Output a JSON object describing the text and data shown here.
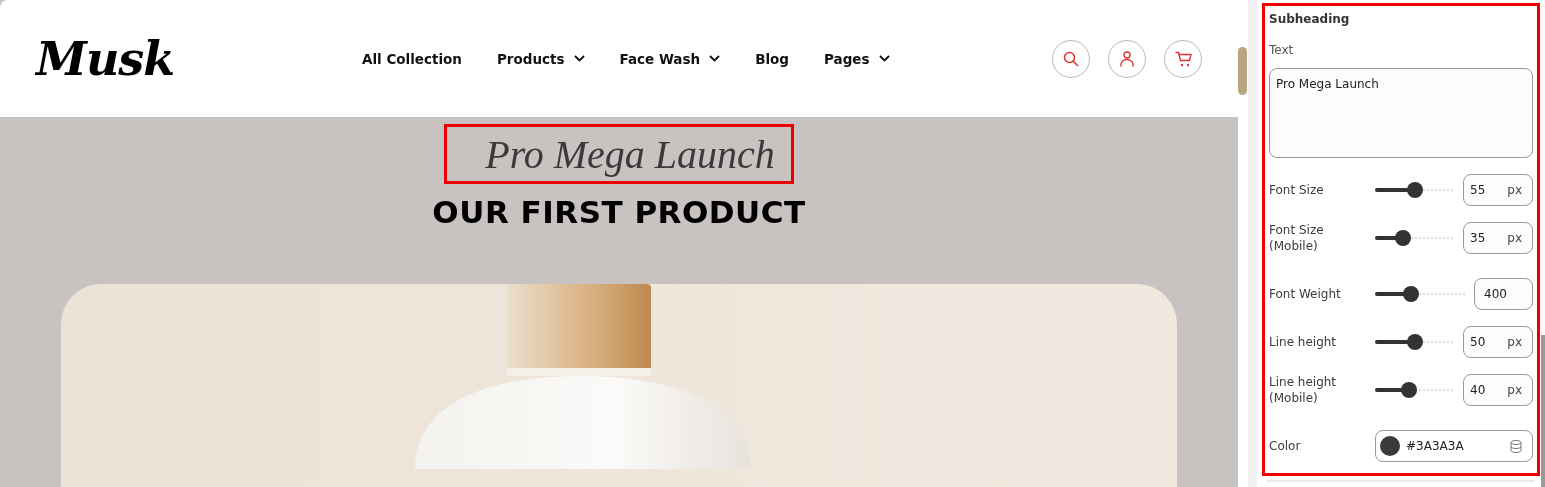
{
  "header": {
    "logo": "Musk",
    "nav": [
      {
        "label": "All Collection",
        "dropdown": false
      },
      {
        "label": "Products",
        "dropdown": true
      },
      {
        "label": "Face Wash",
        "dropdown": true
      },
      {
        "label": "Blog",
        "dropdown": false
      },
      {
        "label": "Pages",
        "dropdown": true
      }
    ]
  },
  "hero": {
    "subheading": {
      "text": "Pro Mega Launch",
      "selected": true
    },
    "heading": "OUR FIRST PRODUCT"
  },
  "settings": {
    "title": "Subheading",
    "selected": true,
    "text_label": "Text",
    "text_value": "Pro Mega Launch",
    "controls": [
      {
        "kind": "slider",
        "label": "Font Size",
        "level": 0.5,
        "value": "55",
        "unit": "px"
      },
      {
        "kind": "slider",
        "label": "Font Size (Mobile)",
        "level": 0.35,
        "value": "35",
        "unit": "px"
      },
      {
        "kind": "slider",
        "label": "Font Weight",
        "level": 0.4,
        "value": "400"
      },
      {
        "kind": "slider",
        "label": "Line height",
        "level": 0.5,
        "value": "50",
        "unit": "px"
      },
      {
        "kind": "slider",
        "label": "Line height (Mobile)",
        "level": 0.42,
        "value": "40",
        "unit": "px"
      },
      {
        "kind": "color",
        "label": "Color",
        "color": "#3a3a3a",
        "value": "#3A3A3A"
      }
    ]
  }
}
